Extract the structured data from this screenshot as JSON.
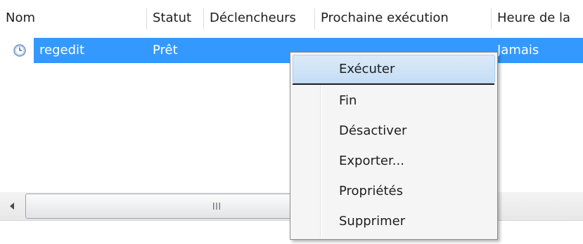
{
  "columns": [
    {
      "label": "Nom"
    },
    {
      "label": "Statut"
    },
    {
      "label": "Déclencheurs"
    },
    {
      "label": "Prochaine exécution"
    },
    {
      "label": "Heure de la"
    }
  ],
  "task_row": {
    "icon": "clock-icon",
    "name": "regedit",
    "status": "Prêt",
    "last_run": "Jamais"
  },
  "scrollbar": {
    "left_arrow_icon": "chevron-left-icon",
    "grip": "III"
  },
  "context_menu": {
    "items": [
      {
        "label": "Exécuter",
        "hover": true
      },
      {
        "label": "Fin"
      },
      {
        "label": "Désactiver"
      },
      {
        "label": "Exporter..."
      },
      {
        "label": "Propriétés"
      },
      {
        "label": "Supprimer"
      }
    ]
  },
  "colors": {
    "selection": "#3399ff",
    "menu_background": "#f5f5f5",
    "menu_hover": "#c4ddf5"
  }
}
